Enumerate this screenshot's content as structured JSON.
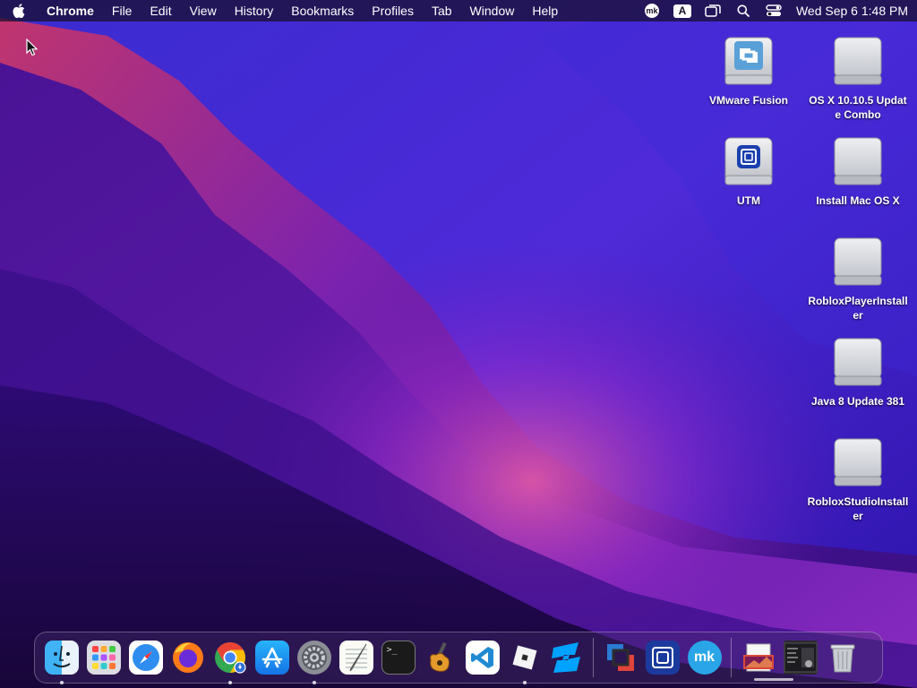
{
  "menubar": {
    "app_name": "Chrome",
    "menus": [
      "File",
      "Edit",
      "View",
      "History",
      "Bookmarks",
      "Profiles",
      "Tab",
      "Window",
      "Help"
    ],
    "status_icons": [
      "mk-icon",
      "input-source-icon",
      "window-icon",
      "spotlight-icon",
      "control-center-icon"
    ],
    "input_source_letter": "A",
    "mk_text": "mk",
    "clock": "Wed Sep 6  1:48 PM"
  },
  "desktop_icons": [
    {
      "label": "VMware Fusion",
      "icon": "vmware-disk-icon"
    },
    {
      "label": "OS X 10.10.5 Update Combo",
      "icon": "disk-image-icon"
    },
    {
      "label": "UTM",
      "icon": "utm-disk-icon"
    },
    {
      "label": "Install Mac OS X",
      "icon": "disk-image-icon"
    },
    {
      "label": "RobloxPlayerInstaller",
      "icon": "disk-image-icon"
    },
    {
      "label": "Java 8 Update 381",
      "icon": "disk-image-icon"
    },
    {
      "label": "RobloxStudioInstaller",
      "icon": "disk-image-icon"
    }
  ],
  "dock": {
    "apps": [
      {
        "name": "finder-icon",
        "running": true
      },
      {
        "name": "launchpad-icon",
        "running": false
      },
      {
        "name": "safari-icon",
        "running": false
      },
      {
        "name": "firefox-icon",
        "running": false
      },
      {
        "name": "chrome-icon",
        "running": true
      },
      {
        "name": "app-store-icon",
        "running": false
      },
      {
        "name": "system-settings-icon",
        "running": true
      },
      {
        "name": "textedit-icon",
        "running": false
      },
      {
        "name": "terminal-icon",
        "running": false
      },
      {
        "name": "garageband-icon",
        "running": false
      },
      {
        "name": "vscode-icon",
        "running": false
      },
      {
        "name": "roblox-icon",
        "running": true
      },
      {
        "name": "roblox-studio-icon",
        "running": false
      },
      {
        "name": "vmware-fusion-icon",
        "running": false
      },
      {
        "name": "utm-icon",
        "running": false
      },
      {
        "name": "mk-app-icon",
        "running": false
      },
      {
        "name": "preview-document-icon",
        "running": false
      },
      {
        "name": "screenshot-thumbnail-icon",
        "running": false
      },
      {
        "name": "trash-icon",
        "running": false
      }
    ],
    "terminal_prompt": ">_"
  },
  "colors": {
    "wallpaper_dark": "#1c0852",
    "wallpaper_mid": "#4a18b8",
    "wallpaper_pink": "#c43a8a",
    "menubar_bg": "#160e28"
  }
}
